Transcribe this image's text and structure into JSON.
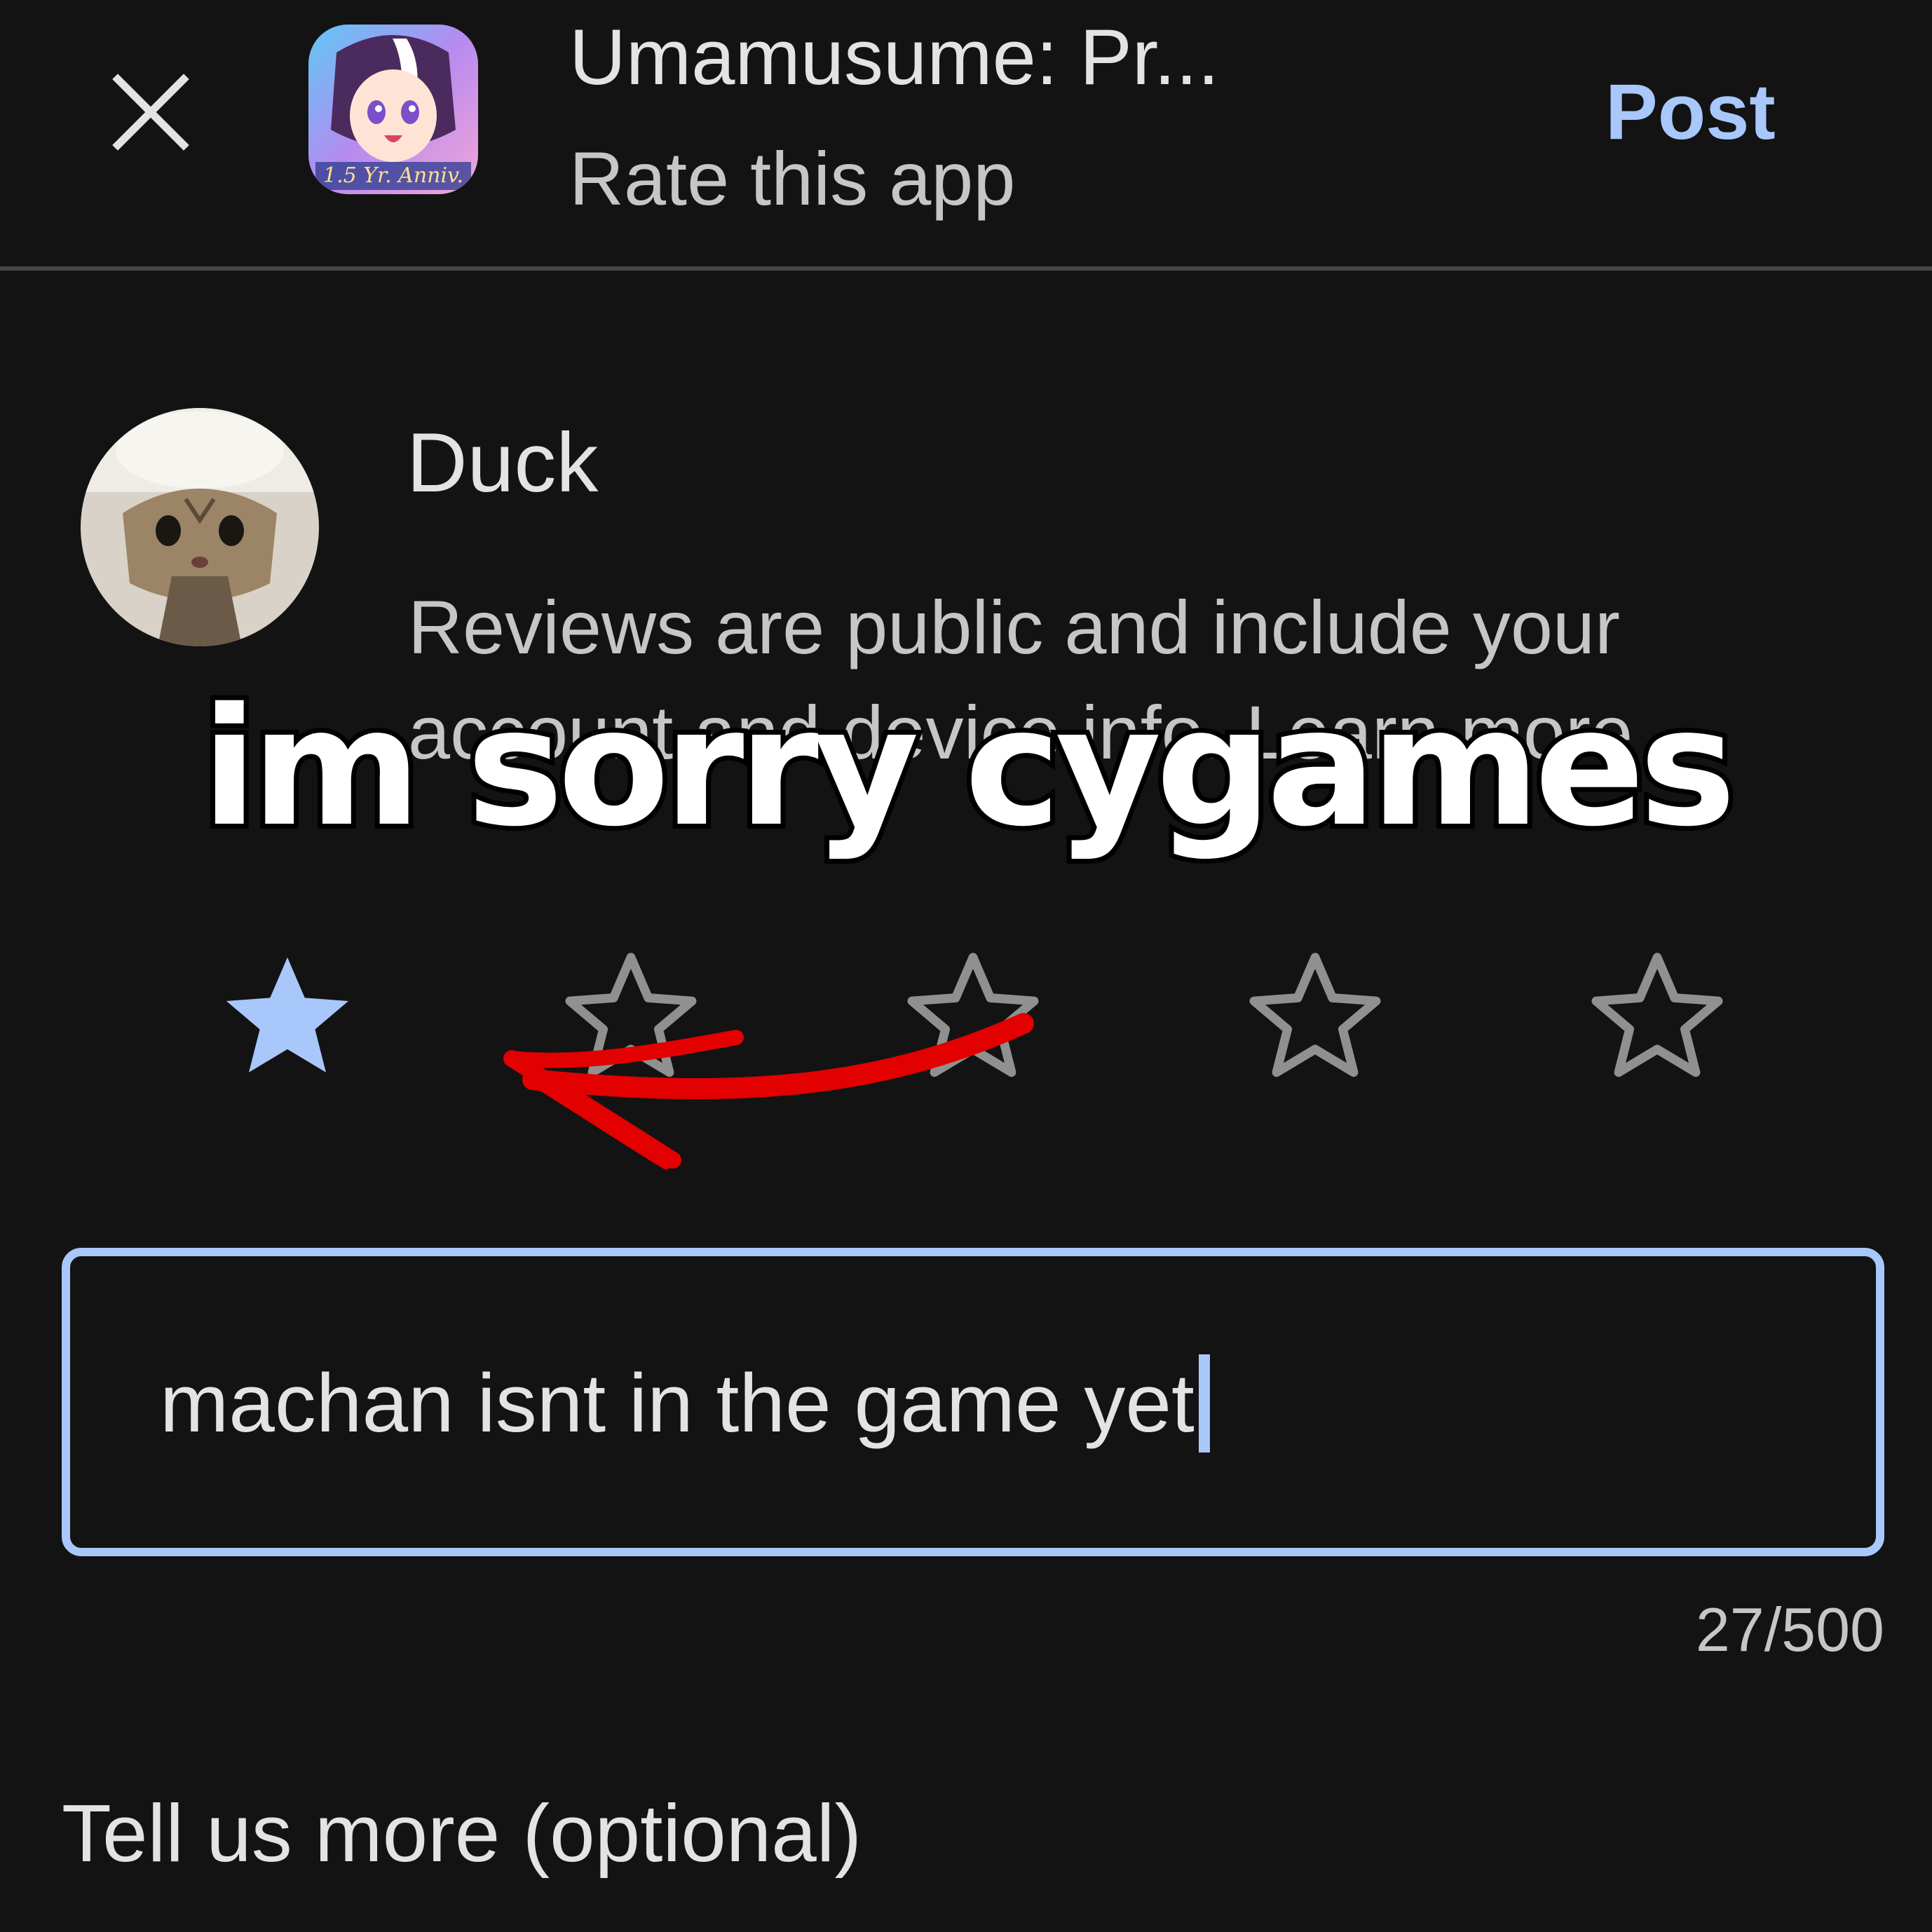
{
  "header": {
    "app_title": "Umamusume: Pr...",
    "subtitle": "Rate this app",
    "post_label": "Post",
    "app_icon_badge": "1.5 Yr. Anniv."
  },
  "user": {
    "name": "Duck",
    "disclaimer": "Reviews are public and include your account and device info. Learn more"
  },
  "overlay": {
    "caption": "im sorry cygames"
  },
  "rating": {
    "selected": 1,
    "max": 5,
    "filled_color": "#a8c7fa",
    "empty_color": "#8e918f"
  },
  "review": {
    "text": "machan isnt in the game yet",
    "char_count": "27/500"
  },
  "more": {
    "label": "Tell us more (optional)"
  },
  "colors": {
    "background": "#131313",
    "accent": "#a8c7fa",
    "arrow": "#e30000"
  }
}
